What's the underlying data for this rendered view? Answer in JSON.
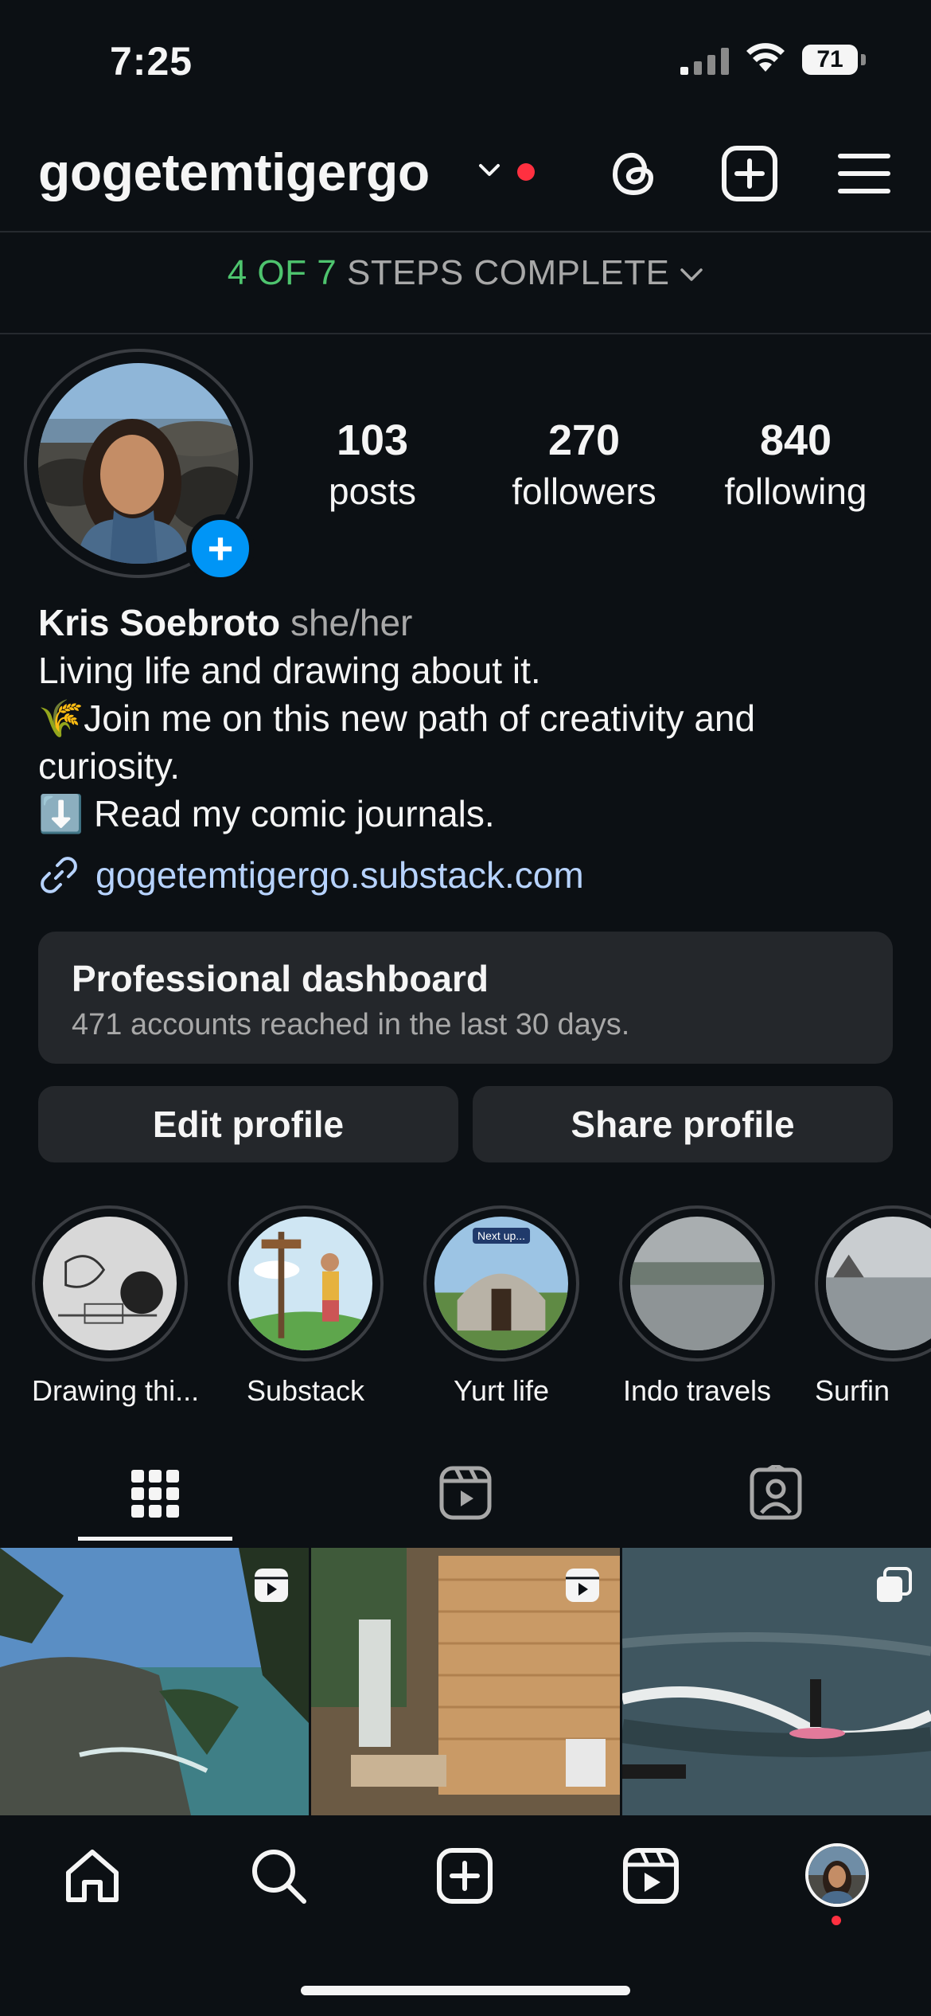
{
  "status_bar": {
    "time": "7:25",
    "battery": "71"
  },
  "header": {
    "username": "gogetemtigergo",
    "icons": [
      "chevron-down-icon",
      "threads-icon",
      "new-post-icon",
      "menu-icon"
    ],
    "notification_color": "#ff3040"
  },
  "steps": {
    "progress": "4 OF 7",
    "label": "STEPS COMPLETE",
    "progress_color": "#4ec46e"
  },
  "profile": {
    "stats": [
      {
        "value": "103",
        "label": "posts"
      },
      {
        "value": "270",
        "label": "followers"
      },
      {
        "value": "840",
        "label": "following"
      }
    ],
    "name": "Kris Soebroto",
    "pronouns": "she/her",
    "bio_lines": [
      "Living life and drawing about it.",
      "🌾Join me on this new path of creativity and",
      "curiosity.",
      "⬇️ Read my comic journals."
    ],
    "link": "gogetemtigergo.substack.com"
  },
  "dashboard": {
    "title": "Professional dashboard",
    "subtitle": "471 accounts reached in the last 30 days."
  },
  "actions": {
    "edit": "Edit profile",
    "share": "Share profile"
  },
  "highlights": [
    {
      "label": "Drawing thi..."
    },
    {
      "label": "Substack"
    },
    {
      "label": "Yurt life",
      "badge": "Next up..."
    },
    {
      "label": "Indo travels"
    },
    {
      "label": "Surfin"
    }
  ],
  "tabs": [
    "grid-icon",
    "reels-icon",
    "tagged-icon"
  ],
  "bottom_nav": [
    "home-icon",
    "search-icon",
    "create-icon",
    "reels-icon",
    "profile-avatar"
  ],
  "colors": {
    "background": "#0c1014",
    "accent": "#0095f6",
    "link": "#b7d3ff"
  }
}
